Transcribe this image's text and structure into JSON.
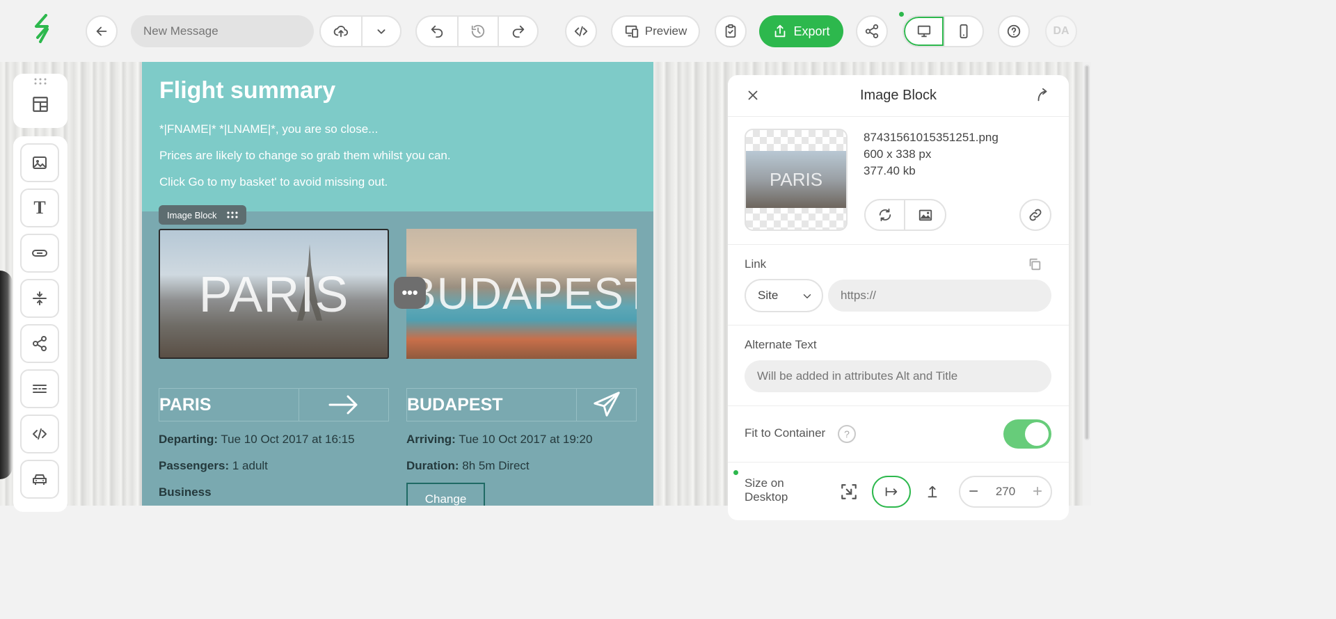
{
  "toolbar": {
    "message_name_placeholder": "New Message",
    "preview_label": "Preview",
    "export_label": "Export",
    "avatar_initials": "DA",
    "accent_color": "#2db84d"
  },
  "email": {
    "title": "Flight summary",
    "line1": "*|FNAME|* *|LNAME|*, you are so close...",
    "line2": "Prices are likely to change so grab them whilst you can.",
    "line3": "Click Go to my basket' to avoid missing out.",
    "image_block_label": "Image Block",
    "paris_image_text": "PARIS",
    "budapest_image_text": "BUDAPEST",
    "paris_heading": "PARIS",
    "budapest_heading": "BUDAPEST",
    "departing_label": "Departing:",
    "departing_value": "Tue 10 Oct 2017 at 16:15",
    "passengers_label": "Passengers:",
    "passengers_value": "1 adult",
    "class_label": "Business",
    "arriving_label": "Arriving:",
    "arriving_value": "Tue 10 Oct 2017 at 19:20",
    "duration_label": "Duration:",
    "duration_value": "8h 5m Direct",
    "change_label": "Change"
  },
  "panel": {
    "title": "Image Block",
    "thumb_text": "PARIS",
    "filename": "87431561015351251.png",
    "dimensions": "600 x 338 px",
    "filesize": "377.40 kb",
    "link_label": "Link",
    "link_type": "Site",
    "link_placeholder": "https://",
    "alt_label": "Alternate Text",
    "alt_placeholder": "Will be added in attributes Alt and Title",
    "fit_label": "Fit to Container",
    "fit_enabled": true,
    "size_label": "Size on Desktop",
    "size_value": "270",
    "help_glyph": "?"
  }
}
